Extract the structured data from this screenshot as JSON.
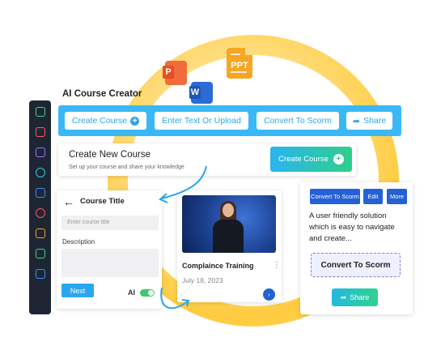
{
  "app": {
    "title": "AI Course Creator"
  },
  "file_icons": {
    "pdf": "P",
    "ppt": "PPT",
    "word": "W"
  },
  "toolbar": {
    "create_course": "Create Course",
    "enter_text": "Enter Text Or Upload",
    "convert": "Convert To Scorm",
    "share": "Share"
  },
  "create_card": {
    "title": "Create New Course",
    "subtitle": "Set up your course and share your knowledge",
    "button": "Create Course"
  },
  "course_form": {
    "heading": "Course Title",
    "title_placeholder": "Enter course title",
    "description_label": "Description",
    "next": "Next",
    "ai_label": "AI"
  },
  "video_card": {
    "title": "Complaince Training",
    "date": "July 18, 2023"
  },
  "scorm_card": {
    "convert_small": "Convert To Scorm",
    "edit": "Edit",
    "more": "More",
    "description": "A user friendly solution which is easy to navigate and create...",
    "convert_big": "Convert To Scorm",
    "share": "Share"
  },
  "colors": {
    "accent": "#2aa6f0",
    "toolbar": "#3ab8f5",
    "sidebar": "#1f2633",
    "deep_blue": "#2461d6",
    "green": "#2ecf8a",
    "circle": "#ffcc40"
  },
  "sidebar": {
    "icons": [
      "home-icon",
      "video-icon",
      "book-icon",
      "chat-icon",
      "audio-icon",
      "settings-icon",
      "image-icon",
      "screen-icon",
      "layout-icon"
    ]
  }
}
